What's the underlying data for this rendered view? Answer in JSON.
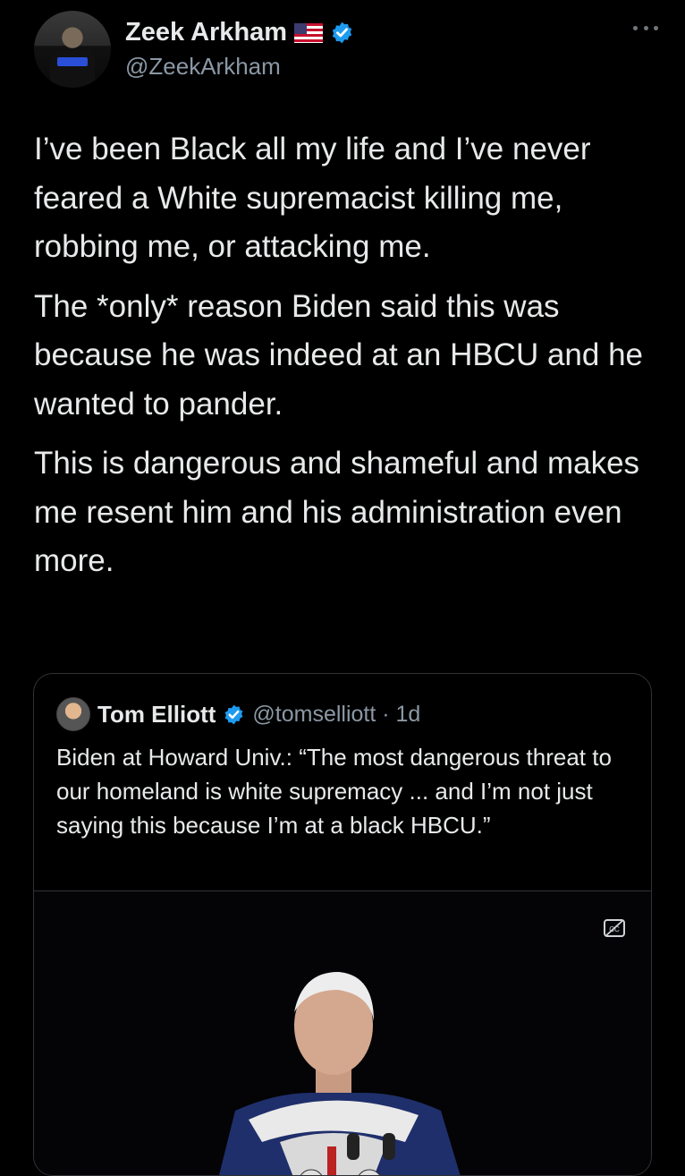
{
  "author": {
    "display_name": "Zeek Arkham",
    "handle": "@ZeekArkham"
  },
  "tweet": {
    "paragraphs": [
      "I’ve been Black all my life and I’ve never feared a White supremacist killing me, robbing me, or attacking me.",
      "The *only* reason Biden said this was because he was indeed at an HBCU and he wanted to pander.",
      "This is dangerous and shameful and makes me resent him and his administration even more."
    ]
  },
  "quote": {
    "display_name": "Tom Elliott",
    "handle_time": "@tomselliott · 1d",
    "text": "Biden at Howard Univ.: “The most dangerous threat to our homeland is white supremacy ... and I’m not just saying this because I’m at a black HBCU.”"
  },
  "colors": {
    "background": "#000000",
    "text": "#e7e9ea",
    "secondary": "#8b98a5",
    "verified": "#1d9bf0"
  },
  "icons": [
    "us-flag-icon",
    "verified-badge-icon",
    "more-options-icon",
    "closed-captions-icon"
  ]
}
